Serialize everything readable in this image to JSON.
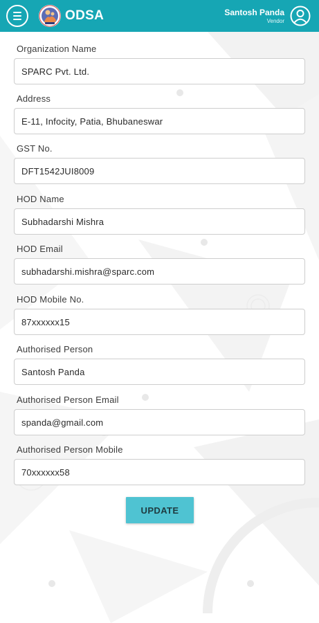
{
  "header": {
    "app_title": "ODSA",
    "user_name": "Santosh Panda",
    "user_role": "Vendor"
  },
  "fields": [
    {
      "label": "Organization Name",
      "value": "SPARC Pvt. Ltd."
    },
    {
      "label": "Address",
      "value": "E-11, Infocity, Patia, Bhubaneswar"
    },
    {
      "label": "GST No.",
      "value": "DFT1542JUI8009"
    },
    {
      "label": "HOD Name",
      "value": "Subhadarshi Mishra"
    },
    {
      "label": "HOD Email",
      "value": "subhadarshi.mishra@sparc.com"
    },
    {
      "label": "HOD Mobile No.",
      "value": "87xxxxxx15"
    },
    {
      "label": "Authorised Person",
      "value": "Santosh Panda"
    },
    {
      "label": "Authorised Person Email",
      "value": "spanda@gmail.com"
    },
    {
      "label": "Authorised Person Mobile",
      "value": "70xxxxxx58"
    }
  ],
  "actions": {
    "update_label": "UPDATE"
  },
  "colors": {
    "header": "#16a6b4",
    "button": "#4fc3d2"
  },
  "icons": {
    "menu": "hamburger-menu-icon",
    "logo": "odsa-logo",
    "user": "user-avatar-icon"
  }
}
